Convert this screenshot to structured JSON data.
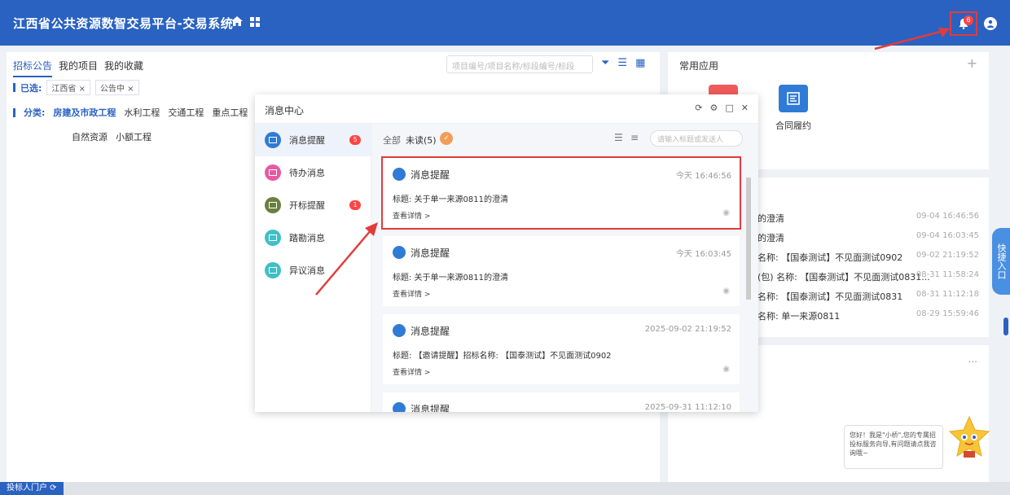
{
  "header": {
    "title": "江西省公共资源数智交易平台-交易系统",
    "bell_badge": "6"
  },
  "left": {
    "tabs": [
      "招标公告",
      "我的项目",
      "我的收藏"
    ],
    "search_placeholder": "项目编号/项目名称/标段编号/标段",
    "selected_label": "已选:",
    "chips": [
      "江西省 ×",
      "公告中 ×"
    ],
    "category_label": "分类:",
    "categories": [
      "房建及市政工程",
      "水利工程",
      "交通工程",
      "重点工程"
    ],
    "categories2": [
      "自然资源",
      "小额工程"
    ]
  },
  "right": {
    "apps_title": "常用应用",
    "plus": "+",
    "app_contract": "合同履约",
    "news": [
      {
        "text": "的澄清",
        "date": "09-04 16:46:56"
      },
      {
        "text": "的澄清",
        "date": "09-04 16:03:45"
      },
      {
        "text": "名称: 【国泰测试】不见面测试0902",
        "date": "09-02 21:19:52"
      },
      {
        "text": "(包) 名称: 【国泰测试】不见面测试0831...",
        "date": "08-31 11:58:24"
      },
      {
        "text": "名称: 【国泰测试】不见面测试0831",
        "date": "08-31 11:12:18"
      },
      {
        "text": "名称: 单一来源0811",
        "date": "08-29 15:59:46"
      }
    ],
    "more": "...",
    "quick_entry": "快捷入口",
    "chat": "您好！我是\"小桥\",您的专属招投标服务向导,有问题请点我咨询哦~"
  },
  "bottom": {
    "portal": "投标人门户 ⟳"
  },
  "modal": {
    "title": "消息中心",
    "side": [
      {
        "label": "消息提醒",
        "badge": "5",
        "color": "#2f7bd6"
      },
      {
        "label": "待办消息",
        "badge": "",
        "color": "#e85aa0"
      },
      {
        "label": "开标提醒",
        "badge": "1",
        "color": "#6b7f3f"
      },
      {
        "label": "踏勘消息",
        "badge": "",
        "color": "#3fbfc7"
      },
      {
        "label": "异议消息",
        "badge": "",
        "color": "#3fbfc7"
      }
    ],
    "filter_all": "全部",
    "filter_unread": "未读(5)",
    "search_placeholder": "请输入标题或发送人",
    "cards": [
      {
        "title": "消息提醒",
        "time": "今天 16:46:56",
        "body": "标题: 关于单一来源0811的澄清",
        "link": "查看详情 >"
      },
      {
        "title": "消息提醒",
        "time": "今天 16:03:45",
        "body": "标题: 关于单一来源0811的澄清",
        "link": "查看详情 >"
      },
      {
        "title": "消息提醒",
        "time": "2025-09-02 21:19:52",
        "body": "标题: 【邀请提醒】招标名称: 【国泰测试】不见面测试0902",
        "link": "查看详情 >"
      },
      {
        "title": "消息提醒",
        "time": "2025-09-31 11:12:10",
        "body": "",
        "link": ""
      }
    ]
  }
}
